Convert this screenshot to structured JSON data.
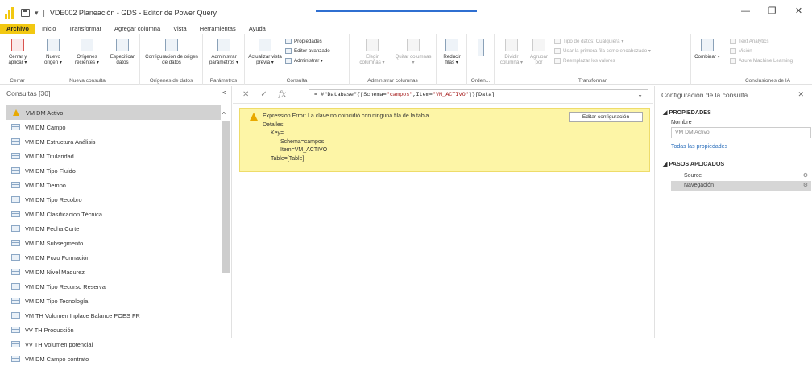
{
  "window": {
    "title": "VDE002 Planeación - GDS - Editor de Power Query",
    "separator": "|",
    "controls": [
      "—",
      "❐",
      "✕"
    ]
  },
  "menu": [
    "Archivo",
    "Inicio",
    "Transformar",
    "Agregar columna",
    "Vista",
    "Herramientas",
    "Ayuda"
  ],
  "ribbon": {
    "cerrar": {
      "btn": "Cerrar y aplicar ▾",
      "label": "Cerrar"
    },
    "nueva_consulta": {
      "btns": [
        "Nuevo origen ▾",
        "Orígenes recientes ▾",
        "Especificar datos"
      ],
      "label": "Nueva consulta"
    },
    "origenes": {
      "btn": "Configuración de origen de datos",
      "label": "Orígenes de datos"
    },
    "parametros": {
      "btn": "Administrar parámetros ▾",
      "label": "Parámetros"
    },
    "consulta": {
      "btn": "Actualizar vista previa ▾",
      "items": [
        "Propiedades",
        "Editor avanzado",
        "Administrar ▾"
      ],
      "label": "Consulta"
    },
    "columnas": {
      "btns": [
        "Elegir columnas ▾",
        "Quitar columnas ▾"
      ],
      "label": "Administrar columnas"
    },
    "filas": {
      "btn": "Reducir filas ▾",
      "label": ""
    },
    "orden": {
      "label": "Orden..."
    },
    "transformar": {
      "btns": [
        "Dividir columna ▾",
        "Agrupar por"
      ],
      "items": [
        "Tipo de datos: Cualquiera ▾",
        "Usar la primera fila como encabezado ▾",
        "Reemplazar los valores"
      ],
      "label": "Transformar"
    },
    "combinar": {
      "btn": "Combinar ▾"
    },
    "ia": {
      "items": [
        "Text Analytics",
        "Visión",
        "Azure Machine Learning"
      ],
      "label": "Conclusiones de IA"
    }
  },
  "queries": {
    "header": "Consultas [30]",
    "collapse": "<",
    "items": [
      "VM DM Activo",
      "VM DM Campo",
      "VM DM Estructura Análisis",
      "VM DM Titularidad",
      "VM DM Tipo Fluido",
      "VM DM Tiempo",
      "VM DM Tipo Recobro",
      "VM DM Clasificacion Técnica",
      "VM DM Fecha Corte",
      "VM DM Subsegmento",
      "VM DM Pozo Formación",
      "VM DM Nivel Madurez",
      "VM DM Tipo Recurso Reserva",
      "VM DM Tipo Tecnología",
      "VM TH Volumen Inplace Balance POES FR",
      "VV TH Producción",
      "VV TH Volumen potencial",
      "VM DM Campo contrato"
    ],
    "scroll_up": "^"
  },
  "formula": {
    "cancel": "✕",
    "ok": "✓",
    "fx": "fx",
    "eq": "= ",
    "prefix": "#\"Database\"{[Schema=",
    "schema": "\"campos\"",
    "mid": ",Item=",
    "item": "\"VM_ACTIVO\"",
    "suffix": "]}[Data]",
    "chevron": "⌄"
  },
  "error": {
    "lines": [
      "Expression.Error: La clave no coincidió con ninguna fila de la tabla.",
      "Detalles:",
      "Key=",
      "Schema=campos",
      "Item=VM_ACTIVO",
      "Table=[Table]"
    ],
    "button": "Editar configuración"
  },
  "settings": {
    "title": "Configuración de la consulta",
    "close": "✕",
    "props_header": "◢ PROPIEDADES",
    "name_label": "Nombre",
    "name_value": "VM DM Activo",
    "all_props": "Todas las propiedades",
    "steps_header": "◢ PASOS APLICADOS",
    "steps": [
      "Source",
      "Navegación"
    ],
    "gear": "⚙",
    "delete": "✕"
  }
}
